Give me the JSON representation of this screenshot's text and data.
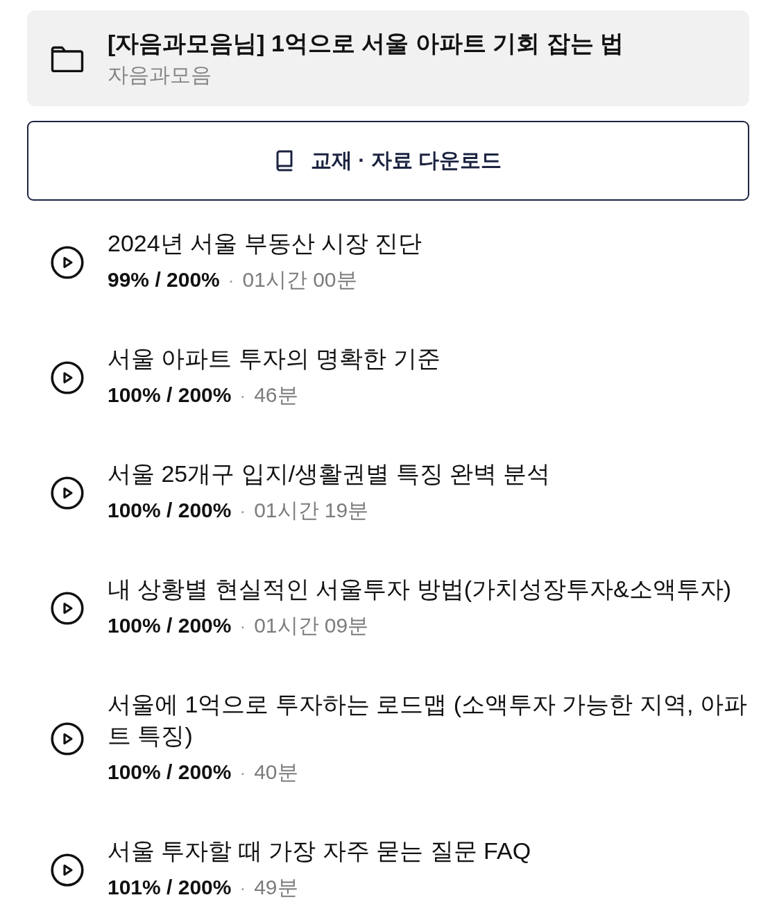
{
  "course": {
    "title": "[자음과모음님] 1억으로 서울 아파트 기회 잡는 법",
    "instructor": "자음과모음"
  },
  "download_button": {
    "label": "교재 · 자료 다운로드"
  },
  "lectures": [
    {
      "title": "2024년 서울 부동산 시장 진단",
      "progress": "99% / 200%",
      "separator": "·",
      "duration": "01시간 00분"
    },
    {
      "title": "서울 아파트 투자의 명확한 기준",
      "progress": "100% / 200%",
      "separator": "·",
      "duration": "46분"
    },
    {
      "title": "서울 25개구 입지/생활권별 특징 완벽 분석",
      "progress": "100% / 200%",
      "separator": "·",
      "duration": "01시간 19분"
    },
    {
      "title": "내 상황별 현실적인 서울투자 방법(가치성장투자&소액투자)",
      "progress": "100% / 200%",
      "separator": "·",
      "duration": "01시간 09분"
    },
    {
      "title": "서울에 1억으로 투자하는 로드맵 (소액투자 가능한 지역, 아파트 특징)",
      "progress": "100% / 200%",
      "separator": "·",
      "duration": "40분"
    },
    {
      "title": "서울 투자할 때 가장 자주 묻는 질문 FAQ",
      "progress": "101% / 200%",
      "separator": "·",
      "duration": "49분"
    }
  ]
}
